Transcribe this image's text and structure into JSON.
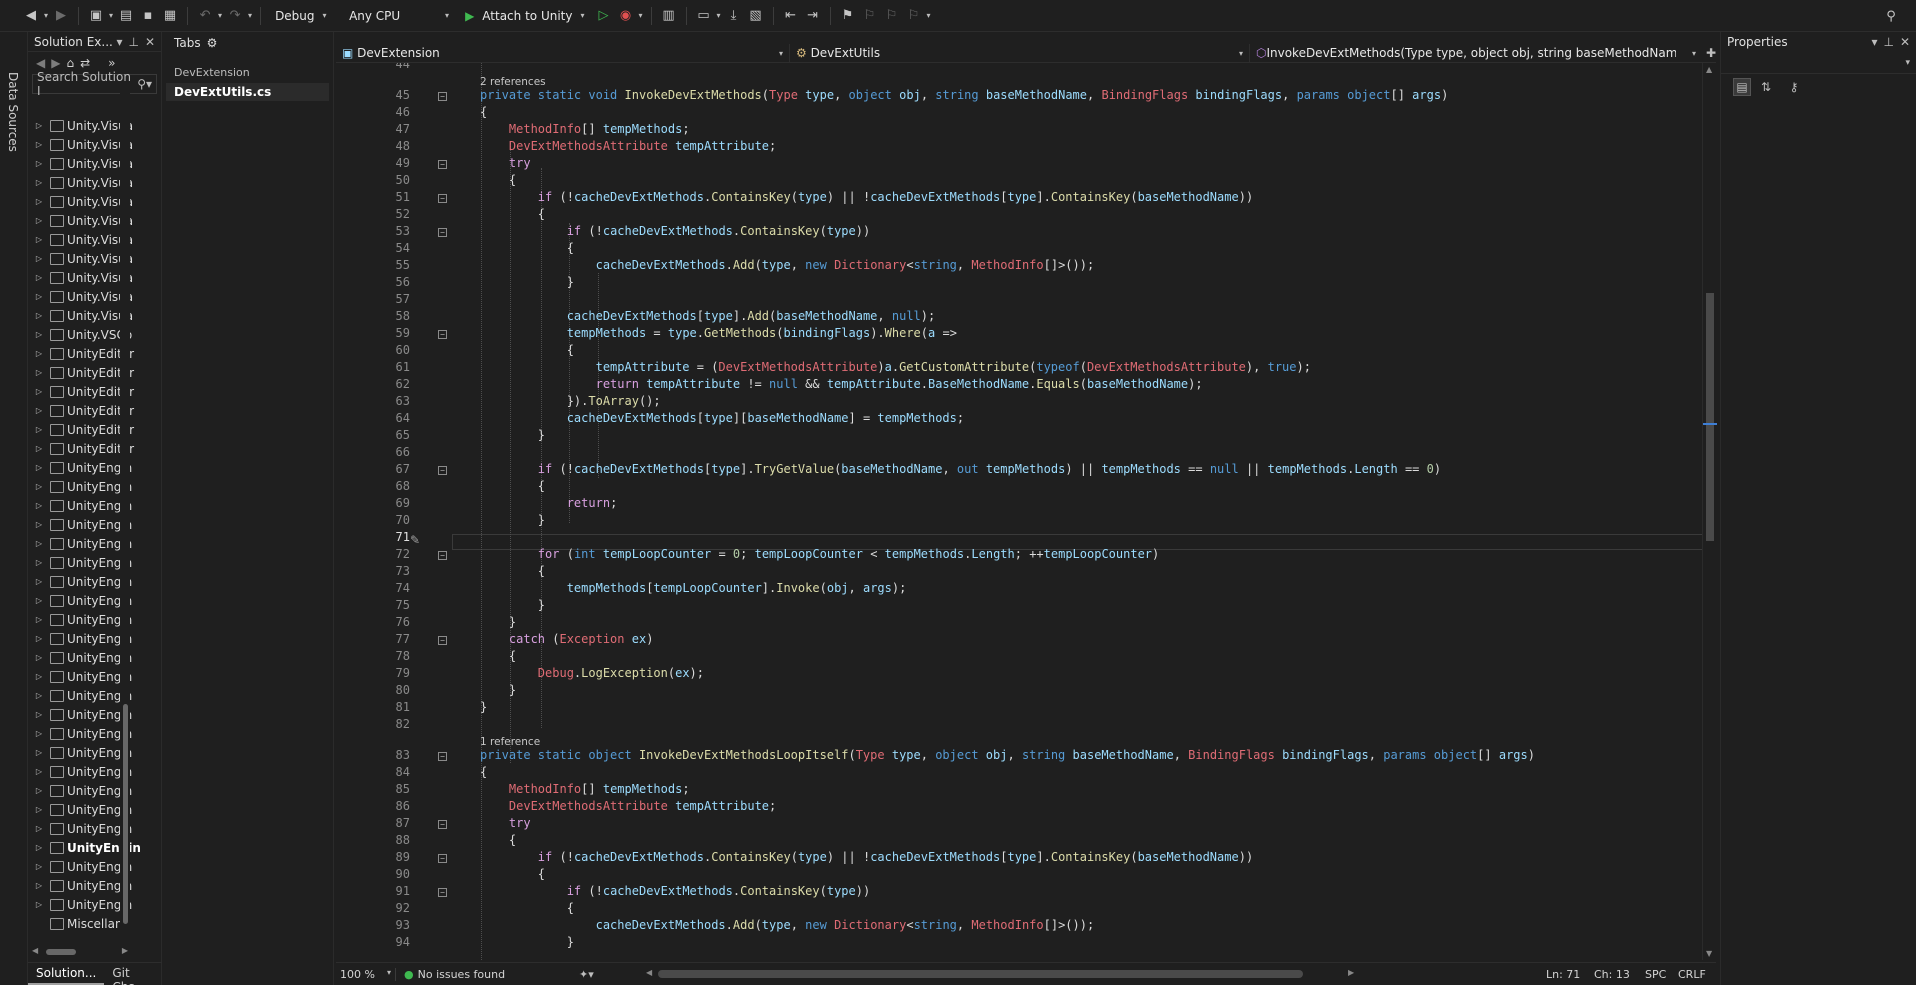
{
  "toolbar": {
    "config": "Debug",
    "platform": "Any CPU",
    "attach": "Attach to Unity"
  },
  "data_sources": {
    "label": "Data Sources"
  },
  "solution": {
    "title": "Solution Ex...",
    "search_placeholder": "Search Solution I",
    "items": [
      "Unity.Visua",
      "Unity.Visua",
      "Unity.Visua",
      "Unity.Visua",
      "Unity.Visua",
      "Unity.Visua",
      "Unity.Visua",
      "Unity.Visua",
      "Unity.Visua",
      "Unity.Visua",
      "Unity.Visua",
      "Unity.VSCo",
      "UnityEditor",
      "UnityEditor",
      "UnityEditor",
      "UnityEditor",
      "UnityEditor",
      "UnityEditor",
      "UnityEngin",
      "UnityEngin",
      "UnityEngin",
      "UnityEngin",
      "UnityEngin",
      "UnityEngin",
      "UnityEngin",
      "UnityEngin",
      "UnityEngin",
      "UnityEngin",
      "UnityEngin",
      "UnityEngin",
      "UnityEngin",
      "UnityEngin",
      "UnityEngin",
      "UnityEngin",
      "UnityEngin",
      "UnityEngin",
      "UnityEngin",
      "UnityEngin",
      "UnityEngin",
      "UnityEngin",
      "UnityEngin",
      "UnityEngin",
      "Miscellane"
    ],
    "bottom_tabs": [
      "Solution...",
      "Git Cha..."
    ]
  },
  "tabs_panel": {
    "title": "Tabs",
    "group": "DevExtension",
    "file": "DevExtUtils.cs"
  },
  "navbar": {
    "project": "DevExtension",
    "class": "DevExtUtils",
    "member": "InvokeDevExtMethods(Type type, object obj, string baseMethodName, BindingI"
  },
  "editor": {
    "lens": [
      {
        "before_line": 45,
        "text": "2 references"
      },
      {
        "before_line": 83,
        "text": "1 reference"
      }
    ],
    "line_start": 44,
    "line_end": 94,
    "current_line": 71
  },
  "status": {
    "zoom": "100 %",
    "issues": "No issues found",
    "ln": "Ln: 71",
    "ch": "Ch: 13",
    "spc": "SPC",
    "crlf": "CRLF"
  },
  "properties": {
    "title": "Properties"
  },
  "colors": {
    "background": "#1f1f1f",
    "keyword": "#569cd6",
    "type": "#4ec9b0",
    "method": "#dcdcaa",
    "number": "#b5cea8"
  }
}
